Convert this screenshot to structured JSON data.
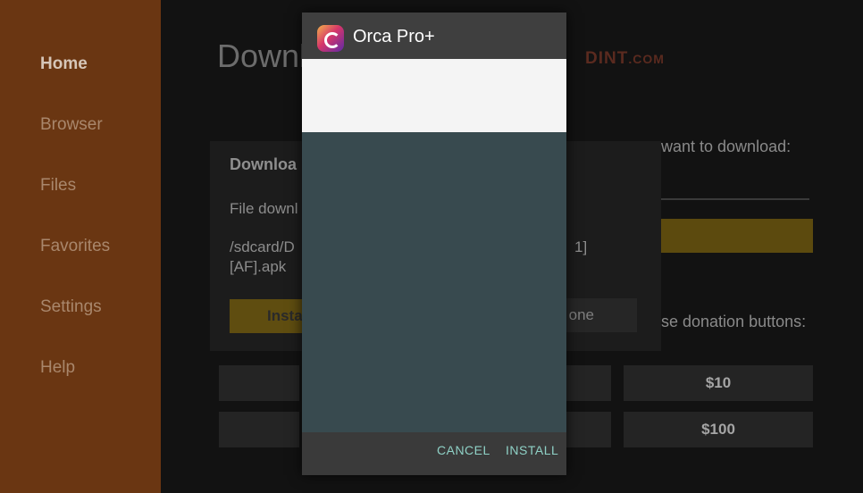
{
  "sidebar": {
    "items": [
      {
        "label": "Home"
      },
      {
        "label": "Browser"
      },
      {
        "label": "Files"
      },
      {
        "label": "Favorites"
      },
      {
        "label": "Settings"
      },
      {
        "label": "Help"
      }
    ]
  },
  "main": {
    "title": "Downl",
    "brand": "DINT",
    "brand_suffix": ".COM",
    "prompt": "want to download:",
    "donation_label": "se donation buttons:",
    "donation_buttons": [
      "$10",
      "$100"
    ]
  },
  "download_dialog": {
    "title": "Downloa",
    "message": "File downl",
    "path_line1": "/sdcard/D",
    "path_line1_tail": "1]",
    "path_line2": "[AF].apk",
    "install_label": "Insta",
    "done_label": "one"
  },
  "installer": {
    "app_name": "Orca Pro+",
    "cancel_label": "CANCEL",
    "install_label": "INSTALL"
  },
  "colors": {
    "sidebar": "#6a3612",
    "accent_yellow": "#5c4a0e",
    "installer_body": "#384a4f",
    "button_text": "#8fd1c6"
  }
}
